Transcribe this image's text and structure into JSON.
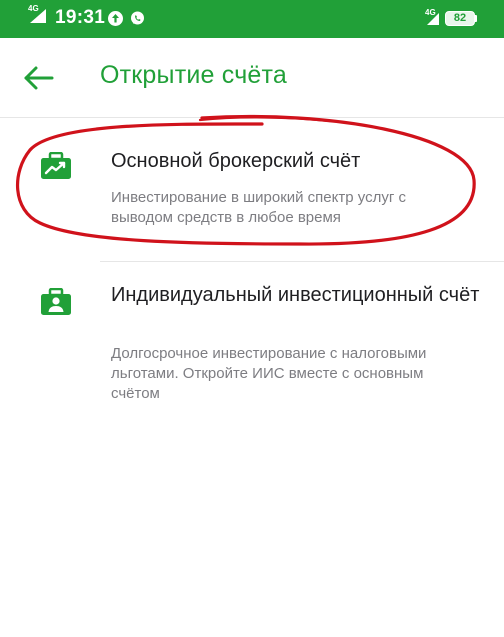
{
  "status_bar": {
    "network_left": "4G",
    "time": "19:31",
    "network_right": "4G",
    "battery": "82",
    "icons": [
      "signal-icon",
      "upload-icon",
      "viber-icon",
      "signal-icon",
      "battery-icon"
    ]
  },
  "header": {
    "back_icon": "arrow-left-icon",
    "title": "Открытие счёта"
  },
  "accounts": [
    {
      "icon": "briefcase-chart-icon",
      "title": "Основной брокерский счёт",
      "description": "Инвестирование в широкий спектр услуг с выводом средств в любое время"
    },
    {
      "icon": "briefcase-person-icon",
      "title": "Индивидуальный инвестиционный счёт",
      "description": "Долгосрочное инвестирование с налоговыми льготами. Откройте ИИС вместе с основным счётом"
    }
  ],
  "colors": {
    "brand_green": "#21a038",
    "annotation_red": "#d0121b",
    "text_primary": "#1f1f22",
    "text_secondary": "#7d7d82"
  }
}
